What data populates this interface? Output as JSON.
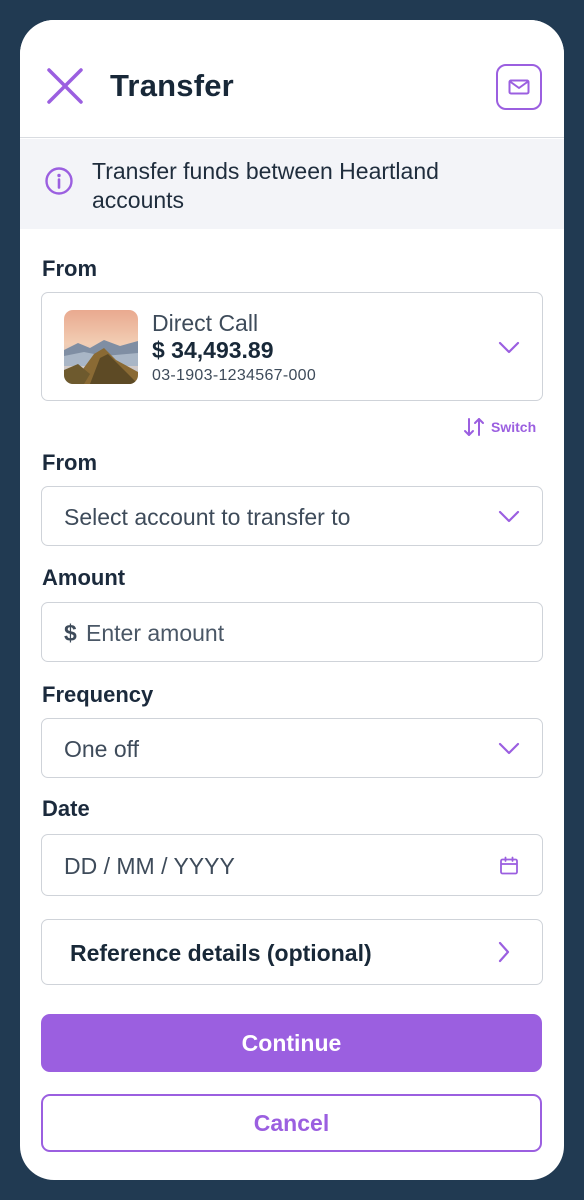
{
  "header": {
    "title": "Transfer",
    "close_icon": "close-icon",
    "mail_icon": "mail-icon"
  },
  "info": {
    "icon": "info-icon",
    "text": "Transfer funds between Heartland accounts"
  },
  "from_section": {
    "label": "From",
    "account": {
      "name": "Direct Call",
      "balance": "$ 34,493.89",
      "number": "03-1903-1234567-000"
    }
  },
  "switch": {
    "label": "Switch",
    "icon": "swap-vertical-icon"
  },
  "to_section": {
    "label": "From",
    "placeholder": "Select account to transfer to"
  },
  "amount": {
    "label": "Amount",
    "currency_symbol": "$",
    "placeholder": "Enter amount",
    "value": ""
  },
  "frequency": {
    "label": "Frequency",
    "value": "One off"
  },
  "date": {
    "label": "Date",
    "placeholder": "DD / MM / YYYY",
    "icon": "calendar-icon"
  },
  "reference": {
    "label": "Reference details (optional)"
  },
  "actions": {
    "continue_label": "Continue",
    "cancel_label": "Cancel"
  },
  "colors": {
    "accent": "#9b5fe0",
    "frame": "#213a52",
    "banner_bg": "#f3f4f8",
    "text_dark": "#182838"
  }
}
